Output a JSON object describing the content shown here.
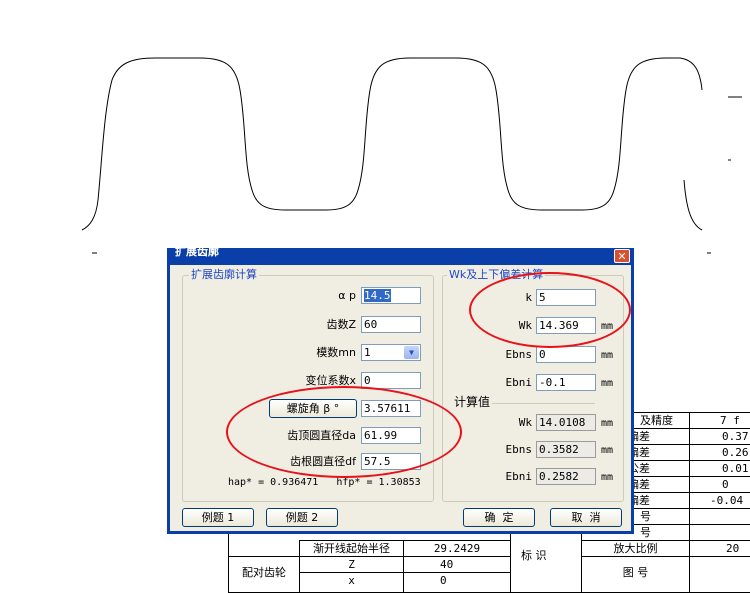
{
  "dialog": {
    "title": "扩展齿廓",
    "close_glyph": "✕",
    "left_group": {
      "title": "扩展齿廓计算",
      "alpha_label": "α p",
      "alpha_value": "14.5",
      "teeth_label": "齿数Z",
      "teeth_value": "60",
      "module_label": "模数mn",
      "module_value": "1",
      "shift_label": "变位系数x",
      "shift_value": "0",
      "helix_button": "螺旋角 β °",
      "helix_value": "3.57611",
      "tip_label": "齿顶圆直径da",
      "tip_value": "61.99",
      "root_label": "齿根圆直径df",
      "root_value": "57.5",
      "coeff_text": "hap* = 0.936471   hfp* = 1.30853"
    },
    "right_group": {
      "title": "Wk及上下偏差计算",
      "k_label": "k",
      "k_value": "5",
      "wk_label": "Wk",
      "wk_value": "14.369",
      "wk_unit": "mm",
      "ebns_label": "Ebns",
      "ebns_value": "0",
      "ebns_unit": "mm",
      "ebni_label": "Ebni",
      "ebni_value": "-0.1",
      "ebni_unit": "mm",
      "calc_title": "计算值",
      "calc_wk_label": "Wk",
      "calc_wk_value": "14.0108",
      "calc_wk_unit": "mm",
      "calc_ebns_label": "Ebns",
      "calc_ebns_value": "0.3582",
      "calc_ebns_unit": "mm",
      "calc_ebni_label": "Ebni",
      "calc_ebni_value": "0.2582",
      "calc_ebni_unit": "mm"
    },
    "buttons": {
      "example1": "例题 1",
      "example2": "例题 2",
      "ok": "确  定",
      "cancel": "取  消"
    }
  },
  "drawing_table": {
    "right_labels": [
      "及精度",
      "偏差",
      "偏差",
      "公差",
      "偏差",
      "偏差",
      "号",
      "号"
    ],
    "right_values": [
      "7 f",
      "0.37",
      "0.26",
      "0.01",
      "0",
      "-0.04",
      "",
      ""
    ],
    "row_start_radius_label": "渐开线起始半径",
    "row_start_radius_value": "29.2429",
    "mark_label": "标   识",
    "scale_label": "放大比例",
    "scale_value": "20",
    "mating_gear_label": "配对齿轮",
    "z_label": "Z",
    "z_value": "40",
    "x_label": "x",
    "x_value": "0",
    "drawing_no_label": "图   号"
  },
  "colors": {
    "dialog_frame": "#0a3ea8",
    "group_title": "#1f46c8",
    "annotation": "#e8121a"
  }
}
